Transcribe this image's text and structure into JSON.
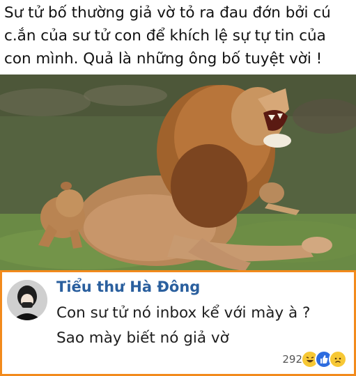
{
  "post": {
    "caption_lines": [
      "Sư tử bố thường giả vờ tỏ ra đau đớn bởi cú",
      "c.ắn của sư tử con để khích lệ sự tự tin của",
      "con mình. Quả là những ông bố tuyệt vời !"
    ]
  },
  "comment": {
    "author": "Tiểu thư Hà Đông",
    "lines": [
      "Con sư tử nó inbox kể với mày à ?",
      "Sao mày biết nó giả vờ"
    ],
    "reaction_count": "292",
    "reactions": [
      "haha-icon",
      "like-icon",
      "sad-icon"
    ]
  },
  "colors": {
    "comment_border": "#f28a1c",
    "author_name": "#2a5f9e"
  }
}
